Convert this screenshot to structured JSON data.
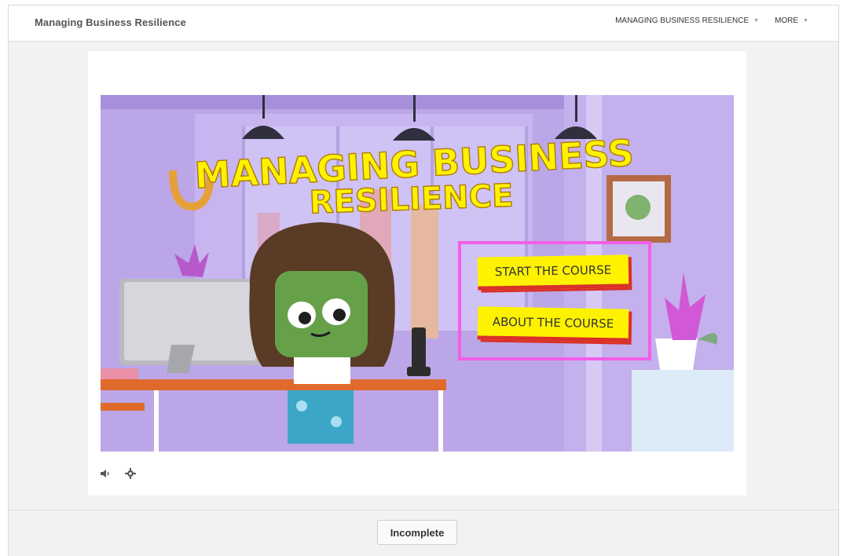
{
  "header": {
    "site_title": "Managing Business Resilience",
    "nav": [
      {
        "label": "MANAGING BUSINESS RESILIENCE"
      },
      {
        "label": "MORE"
      }
    ]
  },
  "scene": {
    "title_line1": "MANAGING BUSINESS",
    "title_line2": "RESILIENCE",
    "buttons": {
      "start": "START THE COURSE",
      "about": "ABOUT THE COURSE"
    },
    "highlight_color": "#f35ee8",
    "button_color": "#fff200",
    "button_shadow_color": "#d9302a",
    "title_color": "#fff200"
  },
  "player_controls": {
    "audio_icon": "speaker-icon",
    "settings_icon": "gear-icon"
  },
  "footer": {
    "status_label": "Incomplete"
  }
}
